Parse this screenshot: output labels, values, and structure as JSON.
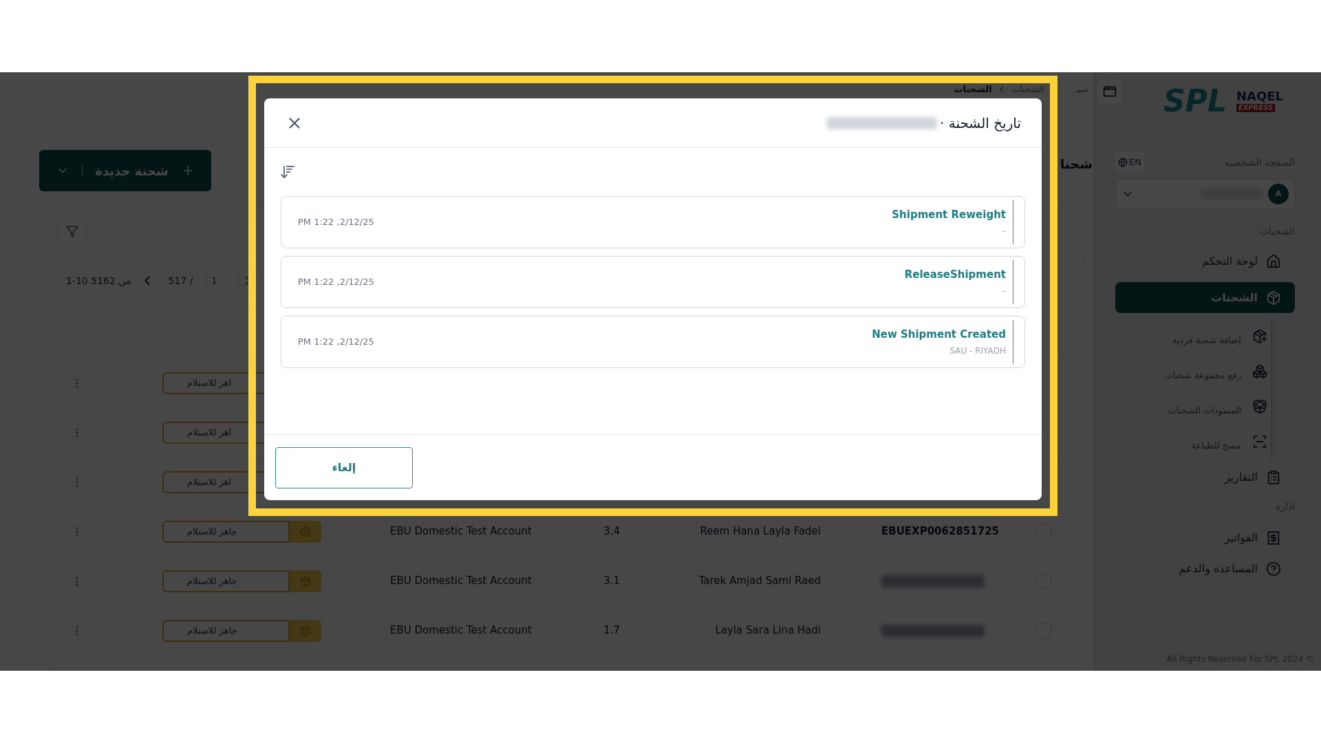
{
  "breadcrumb": [
    {
      "label": "سبـ",
      "selected": false
    },
    {
      "label": "الشحنات",
      "selected": false
    },
    {
      "label": "الشحنات",
      "selected": true
    }
  ],
  "page_title": "شحنا",
  "new_shipment_button": {
    "label": "شحنة جديدة"
  },
  "pagination": {
    "range": "1-10 من 5162",
    "total": "517 /",
    "page": "1"
  },
  "table": {
    "rows": [
      {
        "status": "اهز للاستلام"
      },
      {
        "status": "اهز للاستلام"
      },
      {
        "status": "اهز للاستلام"
      },
      {
        "status": "جاهز للاستلام",
        "account": "EBU Domestic Test Account",
        "weight": "3.4",
        "name": "Reem Hana Layla Fadel",
        "id": "EBUEXP0062851725",
        "checked": false
      },
      {
        "status": "جاهز للاستلام",
        "account": "EBU Domestic Test Account",
        "weight": "3.1",
        "name": "Tarek Amjad Sami Raed",
        "checked": false
      },
      {
        "status": "جاهز للاستلام",
        "account": "EBU Domestic Test Account",
        "weight": "1.7",
        "name": "Layla Sara Lina Hadi",
        "checked": false
      }
    ]
  },
  "sidebar": {
    "logo": {
      "spl": "SPL",
      "naqel": "NAQEL",
      "naqel_sub": "EXPRESS"
    },
    "profile_label": "الصفحة الشخصيه",
    "language": "EN",
    "user": {
      "initial": "A"
    },
    "sections": [
      {
        "heading": "الشحنات",
        "items": [
          {
            "label": "لوحة التحكم",
            "selected": false
          },
          {
            "label": "الشحنات",
            "selected": true,
            "children": [
              {
                "label": "إضافة شحنة فردية"
              },
              {
                "label": "رفع مجموعة شحنات"
              },
              {
                "label": "المسودات الشحنات"
              },
              {
                "label": "مسح للطباعة"
              }
            ]
          },
          {
            "label": "التقارير",
            "selected": false
          }
        ]
      },
      {
        "heading": "ادارة",
        "items": [
          {
            "label": "الفواتير",
            "selected": false
          },
          {
            "label": "المساعدة والدعم",
            "selected": false
          }
        ]
      }
    ],
    "footer": "All Rights Reserved For SPL 2024 ©"
  },
  "modal": {
    "title": "تاريخ الشحنة ·",
    "events": [
      {
        "title": "Shipment Reweight",
        "detail": "-",
        "time": "PM 1:22 ,2/12/25"
      },
      {
        "title": "ReleaseShipment",
        "detail": "-",
        "time": "PM 1:22 ,2/12/25"
      },
      {
        "title": "New Shipment Created",
        "detail": "SAU - RIYADH",
        "time": "PM 1:22 ,2/12/25"
      }
    ],
    "cancel_button": "إلغاء"
  }
}
